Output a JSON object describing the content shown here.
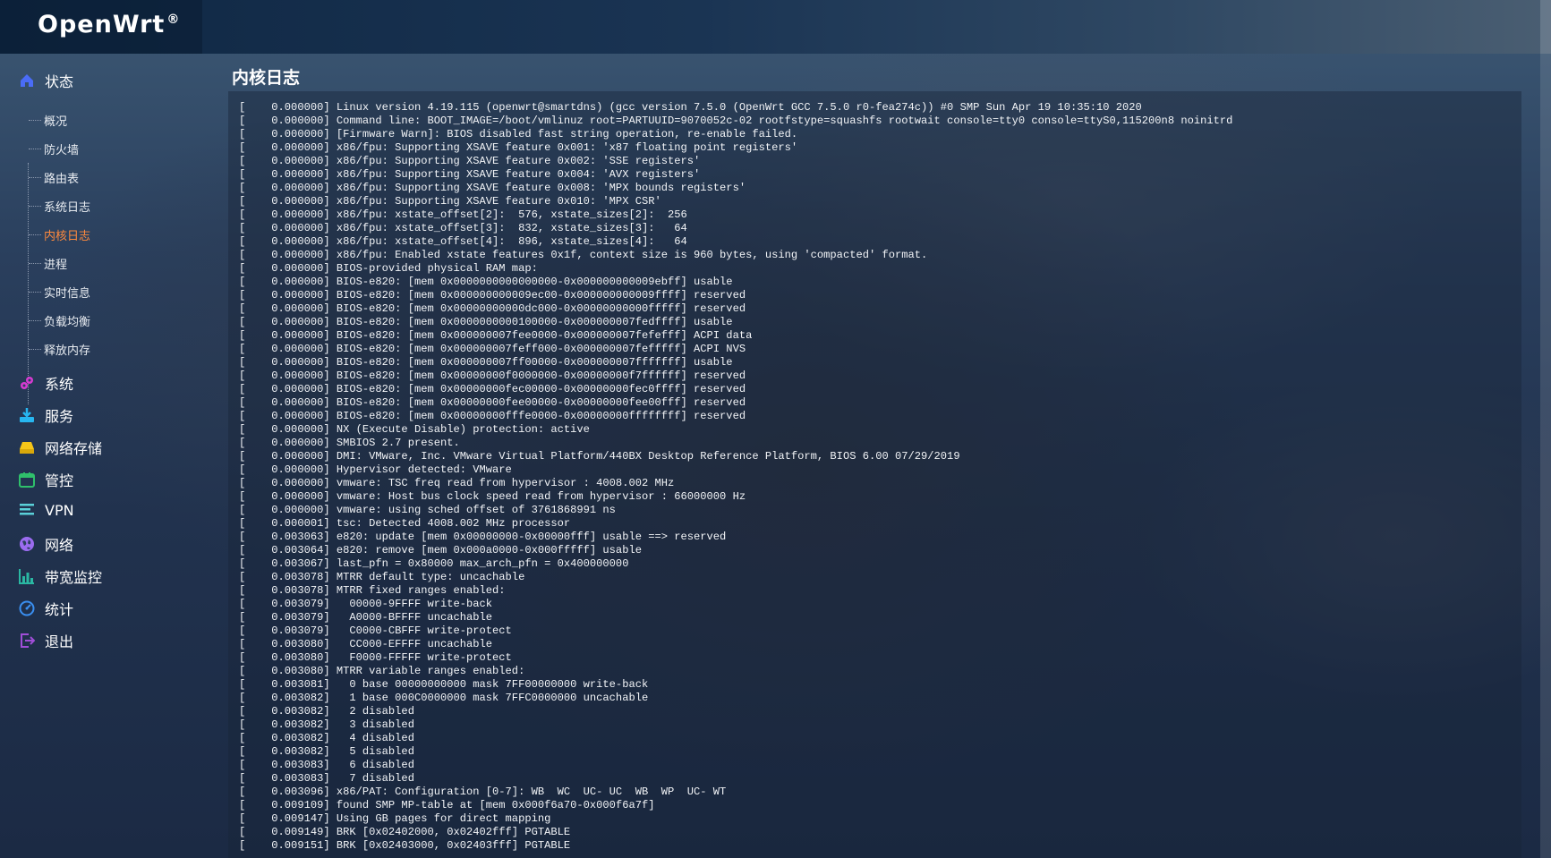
{
  "brand": {
    "name": "OpenWrt",
    "mark": "®"
  },
  "sidebar": {
    "groups": [
      {
        "label": "状态",
        "icon": "home-icon",
        "color": "#4a6cf7"
      },
      {
        "label": "系统",
        "icon": "gear-cluster-icon",
        "color": "#d63bd1"
      },
      {
        "label": "服务",
        "icon": "download-tray-icon",
        "color": "#27b6f0"
      },
      {
        "label": "网络存储",
        "icon": "drive-icon",
        "color": "#f5c518"
      },
      {
        "label": "管控",
        "icon": "calendar-icon",
        "color": "#2fc06b"
      },
      {
        "label": "VPN",
        "icon": "lines-icon",
        "color": "#5ad0d8"
      },
      {
        "label": "网络",
        "icon": "globe-icon",
        "color": "#9b6cf0"
      },
      {
        "label": "带宽监控",
        "icon": "bar-chart-icon",
        "color": "#2ab7a2"
      },
      {
        "label": "统计",
        "icon": "gauge-icon",
        "color": "#3a8ff0"
      },
      {
        "label": "退出",
        "icon": "logout-icon",
        "color": "#a04ed8"
      }
    ],
    "status_items": [
      "概况",
      "防火墙",
      "路由表",
      "系统日志",
      "内核日志",
      "进程",
      "实时信息",
      "负载均衡",
      "释放内存"
    ],
    "active_item": "内核日志",
    "active_color": "#ff8a3d"
  },
  "page": {
    "title": "内核日志"
  },
  "log_lines": [
    "[    0.000000] Linux version 4.19.115 (openwrt@smartdns) (gcc version 7.5.0 (OpenWrt GCC 7.5.0 r0-fea274c)) #0 SMP Sun Apr 19 10:35:10 2020",
    "[    0.000000] Command line: BOOT_IMAGE=/boot/vmlinuz root=PARTUUID=9070052c-02 rootfstype=squashfs rootwait console=tty0 console=ttyS0,115200n8 noinitrd",
    "[    0.000000] [Firmware Warn]: BIOS disabled fast string operation, re-enable failed.",
    "[    0.000000] x86/fpu: Supporting XSAVE feature 0x001: 'x87 floating point registers'",
    "[    0.000000] x86/fpu: Supporting XSAVE feature 0x002: 'SSE registers'",
    "[    0.000000] x86/fpu: Supporting XSAVE feature 0x004: 'AVX registers'",
    "[    0.000000] x86/fpu: Supporting XSAVE feature 0x008: 'MPX bounds registers'",
    "[    0.000000] x86/fpu: Supporting XSAVE feature 0x010: 'MPX CSR'",
    "[    0.000000] x86/fpu: xstate_offset[2]:  576, xstate_sizes[2]:  256",
    "[    0.000000] x86/fpu: xstate_offset[3]:  832, xstate_sizes[3]:   64",
    "[    0.000000] x86/fpu: xstate_offset[4]:  896, xstate_sizes[4]:   64",
    "[    0.000000] x86/fpu: Enabled xstate features 0x1f, context size is 960 bytes, using 'compacted' format.",
    "[    0.000000] BIOS-provided physical RAM map:",
    "[    0.000000] BIOS-e820: [mem 0x0000000000000000-0x000000000009ebff] usable",
    "[    0.000000] BIOS-e820: [mem 0x000000000009ec00-0x000000000009ffff] reserved",
    "[    0.000000] BIOS-e820: [mem 0x00000000000dc000-0x00000000000fffff] reserved",
    "[    0.000000] BIOS-e820: [mem 0x0000000000100000-0x000000007fedffff] usable",
    "[    0.000000] BIOS-e820: [mem 0x000000007fee0000-0x000000007fefefff] ACPI data",
    "[    0.000000] BIOS-e820: [mem 0x000000007feff000-0x000000007fefffff] ACPI NVS",
    "[    0.000000] BIOS-e820: [mem 0x000000007ff00000-0x000000007fffffff] usable",
    "[    0.000000] BIOS-e820: [mem 0x00000000f0000000-0x00000000f7ffffff] reserved",
    "[    0.000000] BIOS-e820: [mem 0x00000000fec00000-0x00000000fec0ffff] reserved",
    "[    0.000000] BIOS-e820: [mem 0x00000000fee00000-0x00000000fee00fff] reserved",
    "[    0.000000] BIOS-e820: [mem 0x00000000fffe0000-0x00000000ffffffff] reserved",
    "[    0.000000] NX (Execute Disable) protection: active",
    "[    0.000000] SMBIOS 2.7 present.",
    "[    0.000000] DMI: VMware, Inc. VMware Virtual Platform/440BX Desktop Reference Platform, BIOS 6.00 07/29/2019",
    "[    0.000000] Hypervisor detected: VMware",
    "[    0.000000] vmware: TSC freq read from hypervisor : 4008.002 MHz",
    "[    0.000000] vmware: Host bus clock speed read from hypervisor : 66000000 Hz",
    "[    0.000000] vmware: using sched offset of 3761868991 ns",
    "[    0.000001] tsc: Detected 4008.002 MHz processor",
    "[    0.003063] e820: update [mem 0x00000000-0x00000fff] usable ==> reserved",
    "[    0.003064] e820: remove [mem 0x000a0000-0x000fffff] usable",
    "[    0.003067] last_pfn = 0x80000 max_arch_pfn = 0x400000000",
    "[    0.003078] MTRR default type: uncachable",
    "[    0.003078] MTRR fixed ranges enabled:",
    "[    0.003079]   00000-9FFFF write-back",
    "[    0.003079]   A0000-BFFFF uncachable",
    "[    0.003079]   C0000-CBFFF write-protect",
    "[    0.003080]   CC000-EFFFF uncachable",
    "[    0.003080]   F0000-FFFFF write-protect",
    "[    0.003080] MTRR variable ranges enabled:",
    "[    0.003081]   0 base 00000000000 mask 7FF00000000 write-back",
    "[    0.003082]   1 base 000C0000000 mask 7FFC0000000 uncachable",
    "[    0.003082]   2 disabled",
    "[    0.003082]   3 disabled",
    "[    0.003082]   4 disabled",
    "[    0.003082]   5 disabled",
    "[    0.003083]   6 disabled",
    "[    0.003083]   7 disabled",
    "[    0.003096] x86/PAT: Configuration [0-7]: WB  WC  UC- UC  WB  WP  UC- WT",
    "[    0.009109] found SMP MP-table at [mem 0x000f6a70-0x000f6a7f]",
    "[    0.009147] Using GB pages for direct mapping",
    "[    0.009149] BRK [0x02402000, 0x02402fff] PGTABLE",
    "[    0.009151] BRK [0x02403000, 0x02403fff] PGTABLE"
  ]
}
